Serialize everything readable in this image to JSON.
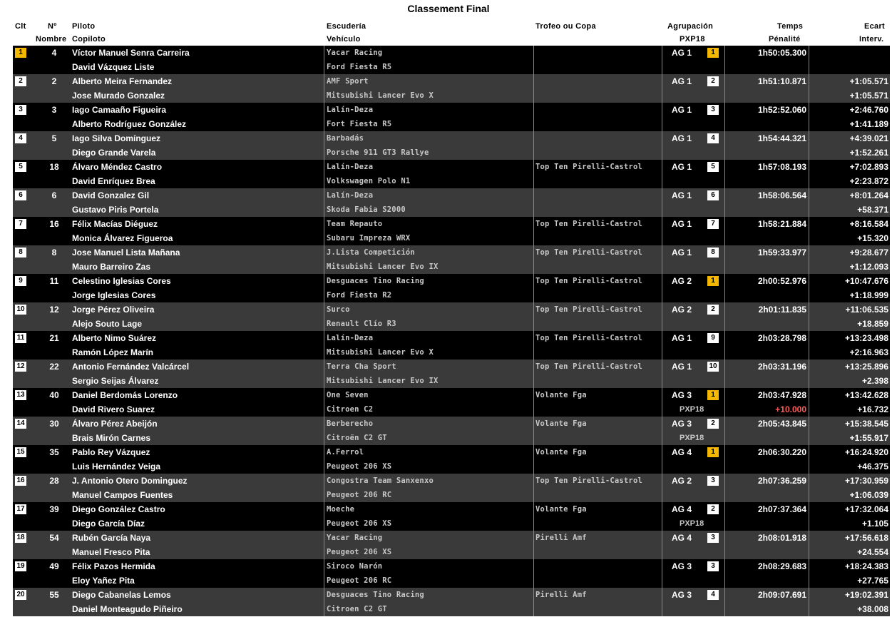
{
  "title": "Classement Final",
  "headers": {
    "clt": "Clt",
    "no": "Nº",
    "nombre": "Nombre",
    "piloto": "Piloto",
    "copiloto": "Copiloto",
    "escuderia": "Escudería",
    "vehiculo": "Vehículo",
    "trofeo": "Trofeo ou Copa",
    "agrupacion": "Agrupación",
    "pxp18": "PXP18",
    "temps": "Temps",
    "penalite": "Pénalité",
    "ecart": "Ecart",
    "interv": "Interv."
  },
  "rows": [
    {
      "pos": "1",
      "num": "4",
      "pilot": "Víctor Manuel Senra Carreira",
      "copilot": "David Vázquez Liste",
      "team": "Yacar Racing",
      "car": "Ford Fiesta R5",
      "trophy": "",
      "group": "AG 1",
      "group_pos": "1",
      "group_sub": "",
      "time": "1h50:05.300",
      "penalty": "",
      "ecart": "",
      "interv": ""
    },
    {
      "pos": "2",
      "num": "2",
      "pilot": "Alberto Meira Fernandez",
      "copilot": "Jose Murado Gonzalez",
      "team": "AMF Sport",
      "car": "Mitsubishi Lancer Evo X",
      "trophy": "",
      "group": "AG 1",
      "group_pos": "2",
      "group_sub": "",
      "time": "1h51:10.871",
      "penalty": "",
      "ecart": "+1:05.571",
      "interv": "+1:05.571"
    },
    {
      "pos": "3",
      "num": "3",
      "pilot": "Iago Camaaño Figueira",
      "copilot": "Alberto Rodríguez González",
      "team": "Lalín-Deza",
      "car": "Fort Fiesta R5",
      "trophy": "",
      "group": "AG 1",
      "group_pos": "3",
      "group_sub": "",
      "time": "1h52:52.060",
      "penalty": "",
      "ecart": "+2:46.760",
      "interv": "+1:41.189"
    },
    {
      "pos": "4",
      "num": "5",
      "pilot": "Iago Silva Domínguez",
      "copilot": "Diego Grande Varela",
      "team": "Barbadás",
      "car": "Porsche 911 GT3 Rallye",
      "trophy": "",
      "group": "AG 1",
      "group_pos": "4",
      "group_sub": "",
      "time": "1h54:44.321",
      "penalty": "",
      "ecart": "+4:39.021",
      "interv": "+1:52.261"
    },
    {
      "pos": "5",
      "num": "18",
      "pilot": "Álvaro Méndez Castro",
      "copilot": "David Enríquez Brea",
      "team": "Lalín-Deza",
      "car": "Volkswagen Polo N1",
      "trophy": "Top Ten Pirelli-Castrol",
      "group": "AG 1",
      "group_pos": "5",
      "group_sub": "",
      "time": "1h57:08.193",
      "penalty": "",
      "ecart": "+7:02.893",
      "interv": "+2:23.872"
    },
    {
      "pos": "6",
      "num": "6",
      "pilot": "David Gonzalez Gil",
      "copilot": "Gustavo Piris Portela",
      "team": "Lalín-Deza",
      "car": "Skoda Fabia S2000",
      "trophy": "",
      "group": "AG 1",
      "group_pos": "6",
      "group_sub": "",
      "time": "1h58:06.564",
      "penalty": "",
      "ecart": "+8:01.264",
      "interv": "+58.371"
    },
    {
      "pos": "7",
      "num": "16",
      "pilot": "Félix Macías Diéguez",
      "copilot": "Monica Álvarez Figueroa",
      "team": "Team Repauto",
      "car": "Subaru Impreza WRX",
      "trophy": "Top Ten Pirelli-Castrol",
      "group": "AG 1",
      "group_pos": "7",
      "group_sub": "",
      "time": "1h58:21.884",
      "penalty": "",
      "ecart": "+8:16.584",
      "interv": "+15.320"
    },
    {
      "pos": "8",
      "num": "8",
      "pilot": "Jose Manuel Lista Mañana",
      "copilot": "Mauro Barreiro Zas",
      "team": "J.Lista Competición",
      "car": "Mitsubishi Lancer Evo IX",
      "trophy": "Top Ten Pirelli-Castrol",
      "group": "AG 1",
      "group_pos": "8",
      "group_sub": "",
      "time": "1h59:33.977",
      "penalty": "",
      "ecart": "+9:28.677",
      "interv": "+1:12.093"
    },
    {
      "pos": "9",
      "num": "11",
      "pilot": "Celestino Iglesias Cores",
      "copilot": "Jorge Iglesias Cores",
      "team": "Desguaces Tino Racing",
      "car": "Ford Fiesta R2",
      "trophy": "Top Ten Pirelli-Castrol",
      "group": "AG 2",
      "group_pos": "1",
      "group_sub": "",
      "time": "2h00:52.976",
      "penalty": "",
      "ecart": "+10:47.676",
      "interv": "+1:18.999"
    },
    {
      "pos": "10",
      "num": "12",
      "pilot": "Jorge Pérez Oliveira",
      "copilot": "Alejo Souto Lage",
      "team": "Surco",
      "car": "Renault Clío R3",
      "trophy": "Top Ten Pirelli-Castrol",
      "group": "AG 2",
      "group_pos": "2",
      "group_sub": "",
      "time": "2h01:11.835",
      "penalty": "",
      "ecart": "+11:06.535",
      "interv": "+18.859"
    },
    {
      "pos": "11",
      "num": "21",
      "pilot": "Alberto Nimo Suárez",
      "copilot": "Ramón López Marín",
      "team": "Lalín-Deza",
      "car": "Mitsubishi Lancer Evo X",
      "trophy": "Top Ten Pirelli-Castrol",
      "group": "AG 1",
      "group_pos": "9",
      "group_sub": "",
      "time": "2h03:28.798",
      "penalty": "",
      "ecart": "+13:23.498",
      "interv": "+2:16.963"
    },
    {
      "pos": "12",
      "num": "22",
      "pilot": "Antonio Fernández Valcárcel",
      "copilot": "Sergio Seijas Álvarez",
      "team": "Terra Cha Sport",
      "car": "Mitsubishi Lancer Evo IX",
      "trophy": "Top Ten Pirelli-Castrol",
      "group": "AG 1",
      "group_pos": "10",
      "group_sub": "",
      "time": "2h03:31.196",
      "penalty": "",
      "ecart": "+13:25.896",
      "interv": "+2.398"
    },
    {
      "pos": "13",
      "num": "40",
      "pilot": "Daniel Berdomás Lorenzo",
      "copilot": "David Rivero Suarez",
      "team": "One Seven",
      "car": "Citroen C2",
      "trophy": "Volante Fga",
      "group": "AG 3",
      "group_pos": "1",
      "group_sub": "PXP18",
      "time": "2h03:47.928",
      "penalty": "+10.000",
      "ecart": "+13:42.628",
      "interv": "+16.732"
    },
    {
      "pos": "14",
      "num": "30",
      "pilot": "Álvaro Pérez Abeijón",
      "copilot": "Brais Mirón Carnes",
      "team": "Berberecho",
      "car": "Citroën C2 GT",
      "trophy": "Volante Fga",
      "group": "AG 3",
      "group_pos": "2",
      "group_sub": "PXP18",
      "time": "2h05:43.845",
      "penalty": "",
      "ecart": "+15:38.545",
      "interv": "+1:55.917"
    },
    {
      "pos": "15",
      "num": "35",
      "pilot": "Pablo Rey Vázquez",
      "copilot": "Luis Hernández Veiga",
      "team": "A.Ferrol",
      "car": "Peugeot 206 XS",
      "trophy": "Volante Fga",
      "group": "AG 4",
      "group_pos": "1",
      "group_sub": "",
      "time": "2h06:30.220",
      "penalty": "",
      "ecart": "+16:24.920",
      "interv": "+46.375"
    },
    {
      "pos": "16",
      "num": "28",
      "pilot": "J. Antonio Otero Dominguez",
      "copilot": "Manuel Campos Fuentes",
      "team": "Congostra Team Sanxenxo",
      "car": "Peugeot 206 RC",
      "trophy": "Top Ten Pirelli-Castrol",
      "group": "AG 2",
      "group_pos": "3",
      "group_sub": "",
      "time": "2h07:36.259",
      "penalty": "",
      "ecart": "+17:30.959",
      "interv": "+1:06.039"
    },
    {
      "pos": "17",
      "num": "39",
      "pilot": "Diego González Castro",
      "copilot": "Diego García Díaz",
      "team": "Moeche",
      "car": "Peugeot 206 XS",
      "trophy": "Volante Fga",
      "group": "AG 4",
      "group_pos": "2",
      "group_sub": "PXP18",
      "time": "2h07:37.364",
      "penalty": "",
      "ecart": "+17:32.064",
      "interv": "+1.105"
    },
    {
      "pos": "18",
      "num": "54",
      "pilot": "Rubén García Naya",
      "copilot": "Manuel Fresco Pita",
      "team": "Yacar Racing",
      "car": "Peugeot 206 XS",
      "trophy": "Pirelli Amf",
      "group": "AG 4",
      "group_pos": "3",
      "group_sub": "",
      "time": "2h08:01.918",
      "penalty": "",
      "ecart": "+17:56.618",
      "interv": "+24.554"
    },
    {
      "pos": "19",
      "num": "49",
      "pilot": "Félix Pazos Hermida",
      "copilot": "Eloy Yañez Pita",
      "team": "Siroco Narón",
      "car": "Peugeot 206 RC",
      "trophy": "",
      "group": "AG 3",
      "group_pos": "3",
      "group_sub": "",
      "time": "2h08:29.683",
      "penalty": "",
      "ecart": "+18:24.383",
      "interv": "+27.765"
    },
    {
      "pos": "20",
      "num": "55",
      "pilot": "Diego Cabanelas Lemos",
      "copilot": "Daniel Monteagudo Piñeiro",
      "team": "Desguaces Tino Racing",
      "car": "Citroen C2 GT",
      "trophy": "Pirelli Amf",
      "group": "AG 3",
      "group_pos": "4",
      "group_sub": "",
      "time": "2h09:07.691",
      "penalty": "",
      "ecart": "+19:02.391",
      "interv": "+38.008"
    }
  ],
  "gold_positions": [
    "1"
  ],
  "colors": {
    "gold": "#f5b800",
    "dark_row": "#000000",
    "grey_row": "#3a3a3a",
    "penalty": "#ff5a5a"
  }
}
